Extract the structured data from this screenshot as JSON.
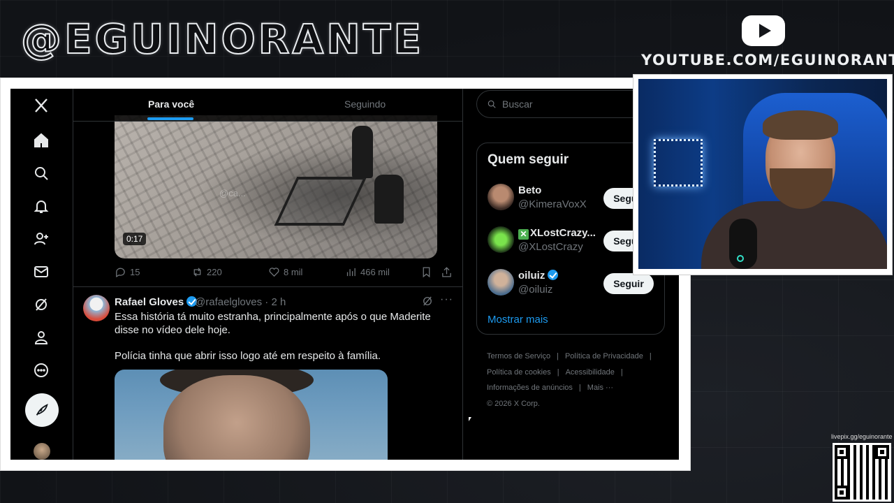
{
  "overlay": {
    "brand": "@EGUINORANTE",
    "youtube_url": "YOUTUBE.COM/EGUINORANTE",
    "qr_label": "livepix.gg/eguinorante"
  },
  "nav": {
    "items": [
      "x-logo-icon",
      "home-icon",
      "explore-icon",
      "notifications-icon",
      "follow-icon",
      "messages-icon",
      "grok-icon",
      "profile-icon",
      "more-icon"
    ],
    "post_icon": "feather-icon"
  },
  "feed": {
    "tabs": [
      {
        "label": "Para você",
        "active": true
      },
      {
        "label": "Seguindo",
        "active": false
      }
    ],
    "tweet1": {
      "video_watermark": "@ca...",
      "duration": "0:17",
      "replies": "15",
      "reposts": "220",
      "likes": "8 mil",
      "views": "466 mil"
    },
    "tweet2": {
      "name": "Rafael Gloves",
      "handle": "@rafaelgloves · 2 h",
      "text1": "Essa história tá muito estranha, principalmente após o que Maderite disse no vídeo dele hoje.",
      "text2": "Polícia tinha que abrir isso logo até em respeito à família."
    }
  },
  "right": {
    "search_placeholder": "Buscar",
    "who_title": "Quem seguir",
    "suggestions": [
      {
        "name": "Beto",
        "handle": "@KimeraVoxX",
        "button": "Seguir"
      },
      {
        "name": "XLostCrazy...",
        "handle": "@XLostCrazy",
        "button": "Seguir"
      },
      {
        "name": "oiluiz",
        "handle": "@oiluiz",
        "button": "Seguir"
      }
    ],
    "show_more": "Mostrar mais",
    "footer": {
      "terms": "Termos de Serviço",
      "privacy": "Política de Privacidade",
      "cookies": "Política de cookies",
      "accessibility": "Acessibilidade",
      "ads": "Informações de anúncios",
      "more": "Mais ···",
      "copyright": "© 2026 X Corp."
    }
  },
  "colors": {
    "accent": "#1d9bf0",
    "background": "#000000",
    "text": "#e7e9ea",
    "muted": "#71767b"
  }
}
